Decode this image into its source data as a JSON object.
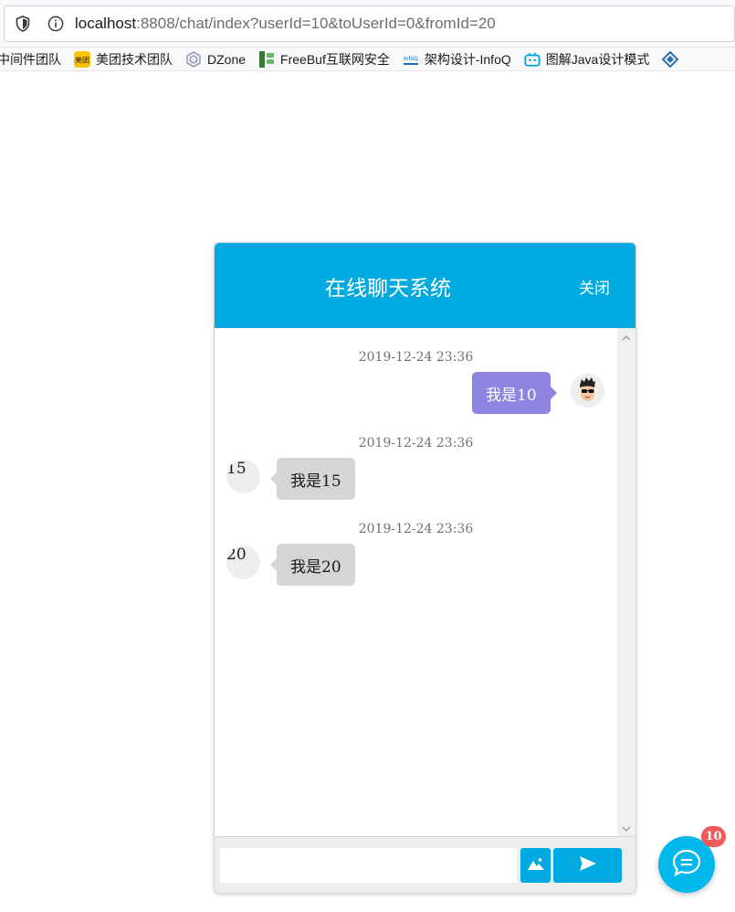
{
  "browser": {
    "url_host": "localhost",
    "url_rest": ":8808/chat/index?userId=10&toUserId=0&fromId=20"
  },
  "bookmarks": [
    {
      "label": "中间件团队",
      "icon": "none"
    },
    {
      "label": "美团技术团队",
      "icon": "meituan-icon",
      "icon_text": "美团",
      "color": "#ffc300"
    },
    {
      "label": "DZone",
      "icon": "dzone-icon",
      "color": "#8a8fb0"
    },
    {
      "label": "FreeBuf互联网安全",
      "icon": "freebuf-icon",
      "color": "#43a047"
    },
    {
      "label": "架构设计-InfoQ",
      "icon": "infoq-icon",
      "icon_text": "InfoQ",
      "color": "#1a6bb8"
    },
    {
      "label": "图解Java设计模式",
      "icon": "bilibili-icon",
      "color": "#00a1d6"
    },
    {
      "label": "",
      "icon": "diamond-icon",
      "color": "#2a6fb0"
    }
  ],
  "chat": {
    "title": "在线聊天系统",
    "close_label": "关闭",
    "colors": {
      "header": "#00a9df",
      "my_bubble": "#8d85e0",
      "other_bubble": "#d5d5d5",
      "badge": "#f05a5a"
    },
    "messages": [
      {
        "time": "2019-12-24 23:36",
        "text": "我是10",
        "side": "right",
        "avatar": "cartoon-avatar"
      },
      {
        "time": "2019-12-24 23:36",
        "text": "我是15",
        "side": "left",
        "avatar_label": "15"
      },
      {
        "time": "2019-12-24 23:36",
        "text": "我是20",
        "side": "left",
        "avatar_label": "20"
      }
    ],
    "input": {
      "value": "",
      "placeholder": ""
    }
  },
  "launcher": {
    "badge_count": "10"
  }
}
